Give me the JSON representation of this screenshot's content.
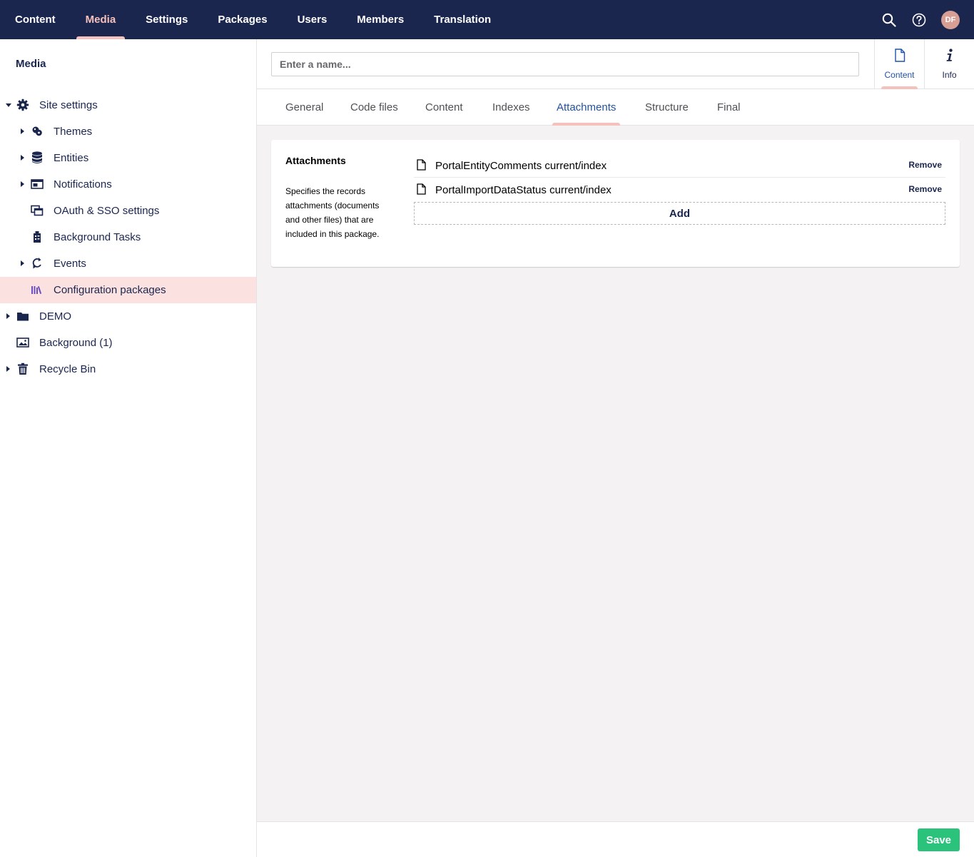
{
  "topnav": {
    "items": [
      {
        "label": "Content",
        "active": false
      },
      {
        "label": "Media",
        "active": true
      },
      {
        "label": "Settings",
        "active": false
      },
      {
        "label": "Packages",
        "active": false
      },
      {
        "label": "Users",
        "active": false
      },
      {
        "label": "Members",
        "active": false
      },
      {
        "label": "Translation",
        "active": false
      }
    ],
    "avatar_initials": "DF"
  },
  "sidebar": {
    "title": "Media",
    "tree": [
      {
        "label": "Site settings",
        "icon": "gear-icon",
        "expanded": true
      },
      {
        "label": "Themes",
        "icon": "palette-icon"
      },
      {
        "label": "Entities",
        "icon": "database-icon"
      },
      {
        "label": "Notifications",
        "icon": "window-icon"
      },
      {
        "label": "OAuth & SSO settings",
        "icon": "windows-stack-icon"
      },
      {
        "label": "Background Tasks",
        "icon": "tasks-icon"
      },
      {
        "label": "Events",
        "icon": "refresh-icon"
      },
      {
        "label": "Configuration packages",
        "icon": "library-icon",
        "selected": true
      },
      {
        "label": "DEMO",
        "icon": "folder-icon"
      },
      {
        "label": "Background (1)",
        "icon": "image-icon"
      },
      {
        "label": "Recycle Bin",
        "icon": "trash-icon"
      }
    ]
  },
  "editor": {
    "name_placeholder": "Enter a name...",
    "apps": [
      {
        "label": "Content",
        "icon": "document-icon",
        "active": true
      },
      {
        "label": "Info",
        "icon": "info-icon",
        "active": false
      }
    ],
    "tabs": [
      {
        "label": "General"
      },
      {
        "label": "Code files"
      },
      {
        "label": "Content"
      },
      {
        "label": "Indexes"
      },
      {
        "label": "Attachments",
        "active": true
      },
      {
        "label": "Structure"
      },
      {
        "label": "Final"
      }
    ],
    "property": {
      "label": "Attachments",
      "description": "Specifies the records attachments (documents and other files) that are included in this package."
    },
    "attachments": [
      {
        "name": "PortalEntityComments current/index",
        "remove_label": "Remove"
      },
      {
        "name": "PortalImportDataStatus current/index",
        "remove_label": "Remove"
      }
    ],
    "add_label": "Add",
    "save_label": "Save"
  },
  "colors": {
    "topbar": "#1b264f",
    "accent": "#f5c1bc",
    "selected_bg": "#fbe1df",
    "active_blue": "#2152a3",
    "save_green": "#2bc37c"
  }
}
